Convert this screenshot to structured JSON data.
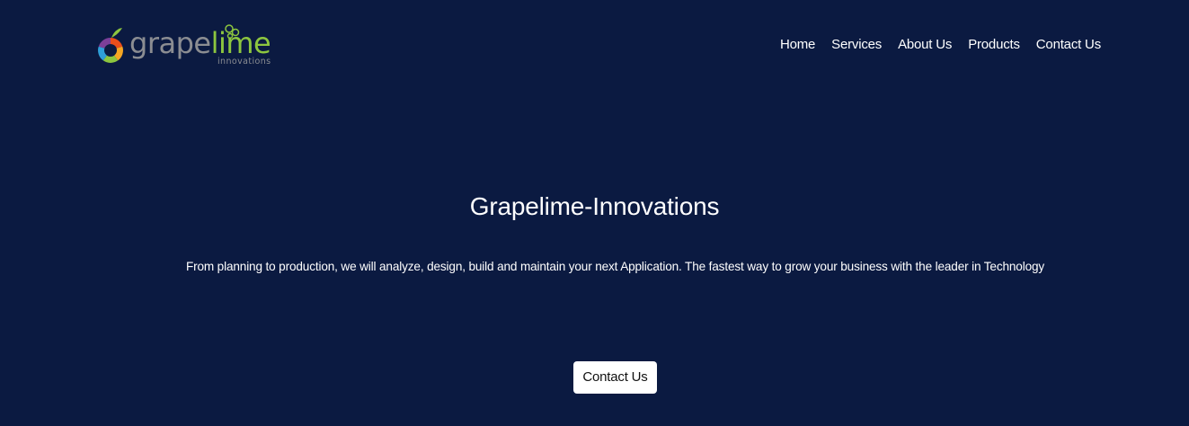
{
  "logo": {
    "word_grape": "grape",
    "word_lime": "lime",
    "subtitle": "innovations",
    "colors": {
      "grape": "#8b8d92",
      "lime": "#8dc63f"
    }
  },
  "nav": {
    "items": [
      {
        "label": "Home"
      },
      {
        "label": "Services"
      },
      {
        "label": "About Us"
      },
      {
        "label": "Products"
      },
      {
        "label": "Contact Us"
      }
    ]
  },
  "hero": {
    "title": "Grapelime-Innovations",
    "subtitle": "From planning to production, we will analyze, design, build and maintain your next Application. The fastest way to grow your business with the leader in Technology",
    "cta_label": "Contact Us"
  },
  "theme": {
    "background": "#0b1a41",
    "text": "#ffffff",
    "button_bg": "#ffffff",
    "button_text": "#111111"
  }
}
